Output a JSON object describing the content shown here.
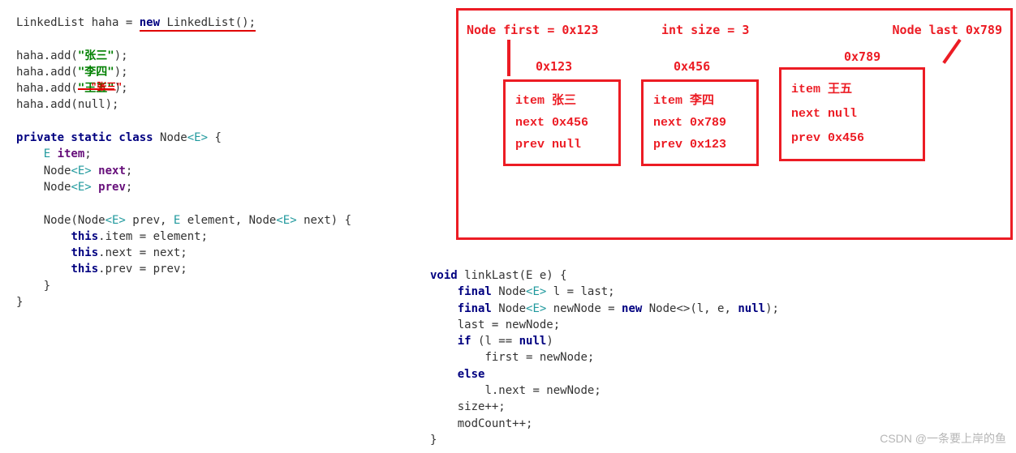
{
  "left_code": {
    "decl_pre": "LinkedList haha = ",
    "decl_kw": "new ",
    "decl_type": "LinkedList",
    "decl_post": "();",
    "add1_pre": "haha.add(",
    "add1_str": "\"张三\"",
    "add1_post": ");",
    "add2_pre": "haha.add(",
    "add2_str": "\"李四\"",
    "add2_post": ");",
    "add3_pre": "haha.add(",
    "add3_str": "\"王五\"",
    "add3_post": ");",
    "add3_overlay": "\"张三\"",
    "add4": "haha.add(null);",
    "cls_mods": "private static class ",
    "cls_name": "Node",
    "cls_gen": "<E>",
    "cls_brace": " {",
    "f1_type": "E ",
    "f1_name": "item",
    "f1_semi": ";",
    "f2_type": "Node",
    "f2_gen": "<E>",
    "f2_name": " next",
    "f2_semi": ";",
    "f3_type": "Node",
    "f3_gen": "<E>",
    "f3_name": " prev",
    "f3_semi": ";",
    "ctor_sig_1": "Node(Node",
    "ctor_sig_2": "<E>",
    "ctor_sig_3": " prev, ",
    "ctor_sig_4": "E",
    "ctor_sig_5": " element, Node",
    "ctor_sig_6": "<E>",
    "ctor_sig_7": " next) {",
    "ctor_l1_this": "this",
    "ctor_l1_rest": ".item = element;",
    "ctor_l2_this": "this",
    "ctor_l2_rest": ".next = next;",
    "ctor_l3_this": "this",
    "ctor_l3_rest": ".prev = prev;",
    "close1": "    }",
    "close2": "}"
  },
  "right_code": {
    "l1_kw": "void ",
    "l1_name": "linkLast",
    "l1_rest": "(E e) {",
    "l2_kw": "final ",
    "l2_type": "Node",
    "l2_gen": "<E>",
    "l2_rest": " l = last;",
    "l3_kw": "final ",
    "l3_type": "Node",
    "l3_gen": "<E>",
    "l3_mid": " newNode = ",
    "l3_kw2": "new ",
    "l3_type2": "Node<>",
    "l3_args": "(l, e, ",
    "l3_null": "null",
    "l3_end": ");",
    "l4": "last = newNode;",
    "l5_kw": "if ",
    "l5_rest": "(l == ",
    "l5_null": "null",
    "l5_end": ")",
    "l6": "first = newNode;",
    "l7_kw": "else",
    "l8": "l.next = newNode;",
    "l9": "size++;",
    "l10": "modCount++;",
    "close": "}"
  },
  "diagram": {
    "first_label": "Node  first =",
    "first_val": "0x123",
    "size_label": "int  size =",
    "size_val": "3",
    "last_label": "Node  last",
    "last_val": "0x789",
    "addr1": "0x123",
    "addr2": "0x456",
    "addr3": "0x789",
    "n1_item_k": "item",
    "n1_item_v": "张三",
    "n1_next_k": "next",
    "n1_next_v": "0x456",
    "n1_prev_k": "prev",
    "n1_prev_v": "null",
    "n2_item_k": "item",
    "n2_item_v": "李四",
    "n2_next_k": "next",
    "n2_next_v": "0x789",
    "n2_prev_k": "prev",
    "n2_prev_v": "0x123",
    "n3_item_k": "item",
    "n3_item_v": "王五",
    "n3_next_k": "next",
    "n3_next_v": "null",
    "n3_prev_k": "prev",
    "n3_prev_v": "0x456"
  },
  "watermark": "CSDN @一条要上岸的鱼"
}
